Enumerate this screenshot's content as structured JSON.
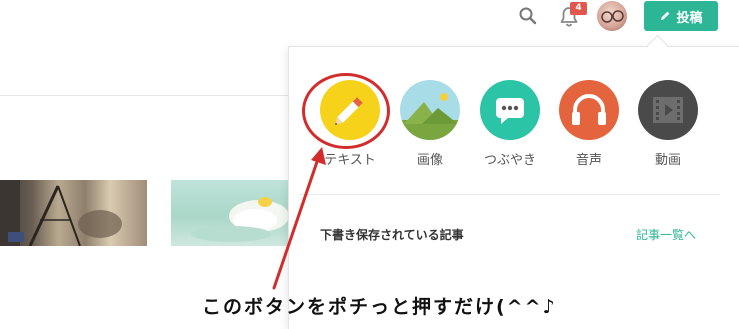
{
  "header": {
    "notification_count": "4",
    "post_label": "投稿",
    "icons": [
      "search-icon",
      "bell-icon",
      "avatar",
      "pencil-icon"
    ],
    "accent_color": "#2cb696"
  },
  "post_types": [
    {
      "label": "テキスト",
      "icon": "pencil-icon",
      "color": "#f7d21a"
    },
    {
      "label": "画像",
      "icon": "image-icon",
      "color": "#a8dce6"
    },
    {
      "label": "つぶやき",
      "icon": "chat-bubble-icon",
      "color": "#2cc4a6"
    },
    {
      "label": "音声",
      "icon": "headphones-icon",
      "color": "#e4643d"
    },
    {
      "label": "動画",
      "icon": "film-icon",
      "color": "#4a4a4a"
    }
  ],
  "drafts": {
    "label": "下書き保存されている記事",
    "link": "記事一覧へ"
  },
  "annotation": {
    "caption": "このボタンをポチっと押すだけ(^^♪",
    "color": "#d22d2d"
  }
}
